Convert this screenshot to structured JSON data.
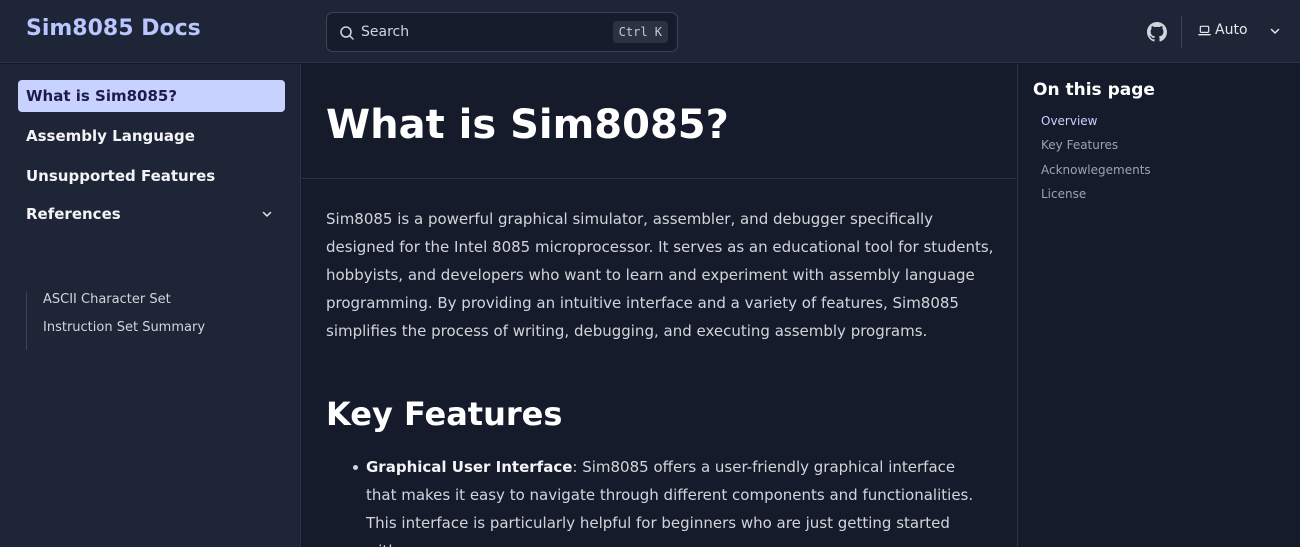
{
  "header": {
    "brand": "Sim8085 Docs",
    "search_label": "Search",
    "search_shortcut": "Ctrl K",
    "theme_label": "Auto"
  },
  "sidebar": {
    "items": [
      {
        "label": "What is Sim8085?"
      },
      {
        "label": "Assembly Language"
      },
      {
        "label": "Unsupported Features"
      },
      {
        "label": "References"
      }
    ],
    "sub_items": [
      {
        "label": "ASCII Character Set"
      },
      {
        "label": "Instruction Set Summary"
      }
    ]
  },
  "main": {
    "title": "What is Sim8085?",
    "intro": "Sim8085 is a powerful graphical simulator, assembler, and debugger specifically designed for the Intel 8085 microprocessor. It serves as an educational tool for students, hobbyists, and developers who want to learn and experiment with assembly language programming. By providing an intuitive interface and a variety of features, Sim8085 simplifies the process of writing, debugging, and executing assembly programs.",
    "h2": "Key Features",
    "feature_title": "Graphical User Interface",
    "feature_text": ": Sim8085 offers a user-friendly graphical interface that makes it easy to navigate through different components and functionalities. This interface is particularly helpful for beginners who are just getting started with"
  },
  "toc": {
    "title": "On this page",
    "items": [
      {
        "label": "Overview"
      },
      {
        "label": "Key Features"
      },
      {
        "label": "Acknowlegements"
      },
      {
        "label": "License"
      }
    ]
  },
  "colors": {
    "accent": "#b9c6ff",
    "active_bg": "#c7d2fe",
    "background": "#151b2b",
    "panel": "#1e2536"
  }
}
